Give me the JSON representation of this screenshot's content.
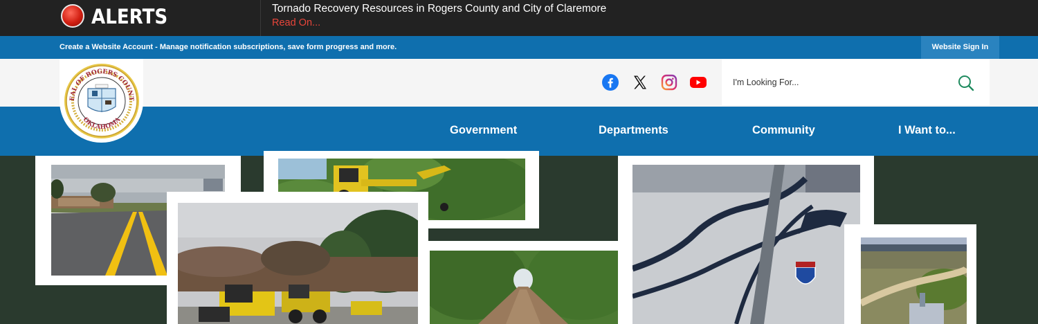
{
  "alert": {
    "title": "ALERTS",
    "message": "Tornado Recovery Resources in Rogers County and City of Claremore",
    "link_label": "Read On..."
  },
  "account": {
    "text": "Create a Website Account - Manage notification subscriptions, save form progress and more.",
    "signin_label": "Website Sign In"
  },
  "social": [
    "facebook-icon",
    "x-icon",
    "instagram-icon",
    "youtube-icon"
  ],
  "search": {
    "placeholder": "I'm Looking For..."
  },
  "logo": {
    "text_top": "SEAL OF ROGERS COUNTY",
    "text_bottom": "OKLAHOMA"
  },
  "nav": {
    "items": [
      "Government",
      "Departments",
      "Community",
      "I Want to..."
    ]
  },
  "colors": {
    "alert_bg": "#222222",
    "brand_blue": "#0f6fae",
    "signin_bg": "#2a83bf",
    "page_bg": "#2a3a2e",
    "alert_link": "#e8453a"
  }
}
